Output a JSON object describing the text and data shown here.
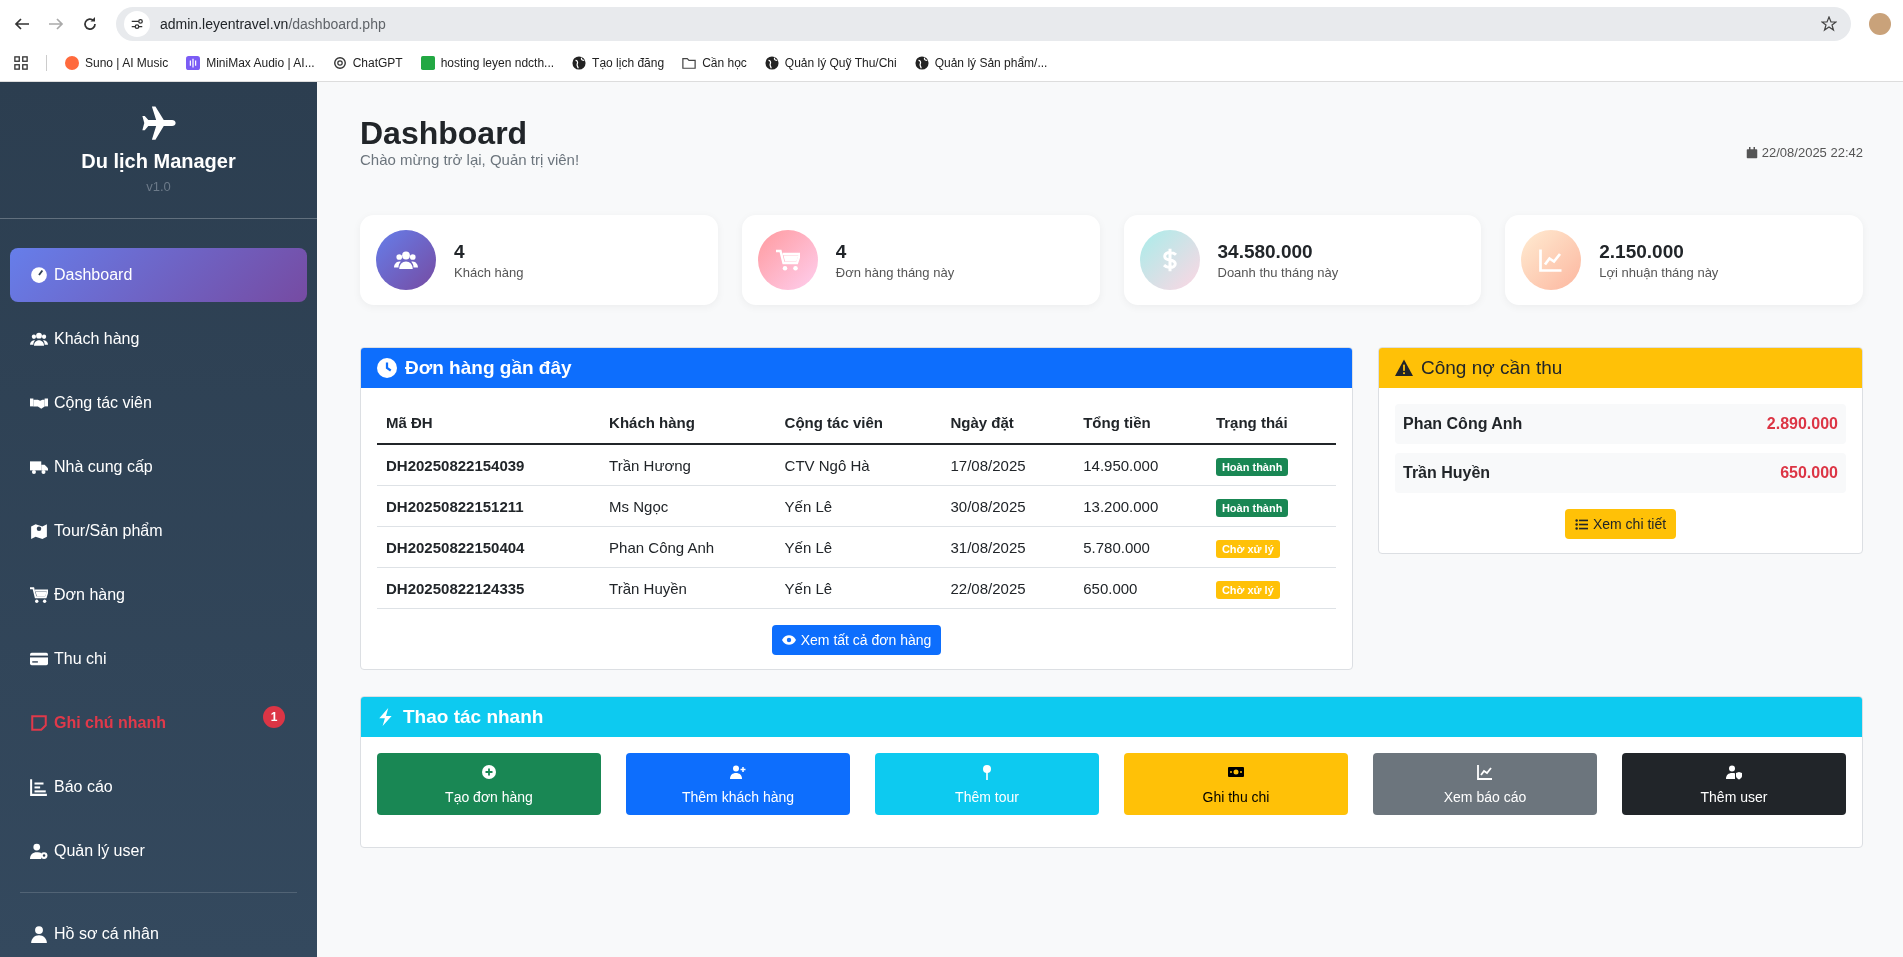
{
  "browser": {
    "url_host": "admin.leyentravel.vn",
    "url_path": "/dashboard.php",
    "bookmarks": [
      {
        "label": "Suno | AI Music"
      },
      {
        "label": "MiniMax Audio | AI..."
      },
      {
        "label": "ChatGPT"
      },
      {
        "label": "hosting leyen ndcth..."
      },
      {
        "label": "Tạo lịch đăng"
      },
      {
        "label": "Cần học"
      },
      {
        "label": "Quản lý Quỹ Thu/Chi"
      },
      {
        "label": "Quản lý Sản phẩm/..."
      }
    ]
  },
  "sidebar": {
    "title": "Du lịch Manager",
    "version": "v1.0",
    "items": [
      {
        "label": "Dashboard",
        "selected": true,
        "kind": "normal"
      },
      {
        "label": "Khách hàng",
        "selected": false,
        "kind": "normal"
      },
      {
        "label": "Cộng tác viên",
        "selected": false,
        "kind": "normal"
      },
      {
        "label": "Nhà cung cấp",
        "selected": false,
        "kind": "normal"
      },
      {
        "label": "Tour/Sản phẩm",
        "selected": false,
        "kind": "normal"
      },
      {
        "label": "Đơn hàng",
        "selected": false,
        "kind": "normal"
      },
      {
        "label": "Thu chi",
        "selected": false,
        "kind": "normal"
      },
      {
        "label": "Ghi chú nhanh",
        "selected": false,
        "kind": "alert",
        "badge": "1"
      },
      {
        "label": "Báo cáo",
        "selected": false,
        "kind": "normal"
      },
      {
        "label": "Quản lý user",
        "selected": false,
        "kind": "normal"
      }
    ],
    "footer_items": [
      {
        "label": "Hồ sơ cá nhân",
        "selected": false
      }
    ]
  },
  "header": {
    "title": "Dashboard",
    "subtitle": "Chào mừng trở lại, Quản trị viên!",
    "datetime": "22/08/2025 22:42"
  },
  "stats": [
    {
      "value": "4",
      "label": "Khách hàng"
    },
    {
      "value": "4",
      "label": "Đơn hàng tháng này"
    },
    {
      "value": "34.580.000",
      "label": "Doanh thu tháng này"
    },
    {
      "value": "2.150.000",
      "label": "Lợi nhuận tháng này"
    }
  ],
  "recent_orders": {
    "title": "Đơn hàng gần đây",
    "columns": [
      "Mã ĐH",
      "Khách hàng",
      "Cộng tác viên",
      "Ngày đặt",
      "Tổng tiền",
      "Trạng thái"
    ],
    "rows": [
      {
        "id": "DH20250822154039",
        "customer": "Trần Hương",
        "collaborator": "CTV Ngô Hà",
        "date": "17/08/2025",
        "total": "14.950.000",
        "status": "Hoàn thành",
        "color": "#198754"
      },
      {
        "id": "DH20250822151211",
        "customer": "Ms Ngọc",
        "collaborator": "Yến Lê",
        "date": "30/08/2025",
        "total": "13.200.000",
        "status": "Hoàn thành",
        "color": "#198754"
      },
      {
        "id": "DH20250822150404",
        "customer": "Phan Công Anh",
        "collaborator": "Yến Lê",
        "date": "31/08/2025",
        "total": "5.780.000",
        "status": "Chờ xử lý",
        "color": "#ffc107"
      },
      {
        "id": "DH20250822124335",
        "customer": "Trần Huyền",
        "collaborator": "Yến Lê",
        "date": "22/08/2025",
        "total": "650.000",
        "status": "Chờ xử lý",
        "color": "#ffc107"
      }
    ],
    "button": "Xem tất cả đơn hàng"
  },
  "debts": {
    "title": "Công nợ cần thu",
    "items": [
      {
        "name": "Phan Công Anh",
        "amount": "2.890.000"
      },
      {
        "name": "Trần Huyền",
        "amount": "650.000"
      }
    ],
    "button": "Xem chi tiết"
  },
  "quick_actions": {
    "title": "Thao tác nhanh",
    "buttons": [
      {
        "label": "Tạo đơn hàng",
        "color": "#198754"
      },
      {
        "label": "Thêm khách hàng",
        "color": "#0d6efd"
      },
      {
        "label": "Thêm tour",
        "color": "#0dcaf0"
      },
      {
        "label": "Ghi thu chi",
        "color": "#ffc107"
      },
      {
        "label": "Xem báo cáo",
        "color": "#6c757d"
      },
      {
        "label": "Thêm user",
        "color": "#212529"
      }
    ]
  }
}
